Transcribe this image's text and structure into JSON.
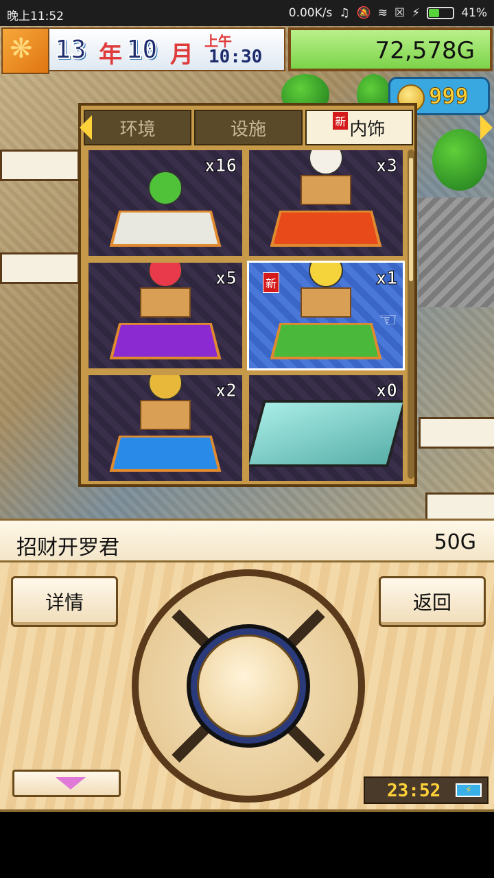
{
  "status_bar": {
    "time": "晚上11:52",
    "network_speed": "0.00K/s",
    "battery_percent": "41%",
    "battery_level": 0.41
  },
  "hud": {
    "year": "13",
    "year_unit": "年",
    "month": "10",
    "month_unit": "月",
    "ampm": "上午",
    "clock": "10:30",
    "money": "72,578G",
    "coins": "999"
  },
  "catalog": {
    "tabs": [
      {
        "label": "环境",
        "active": false,
        "is_new": false
      },
      {
        "label": "设施",
        "active": false,
        "is_new": false
      },
      {
        "label": "内饰",
        "active": true,
        "is_new": true,
        "new_badge": "新"
      }
    ],
    "items": [
      {
        "name": "bamboo-fountain",
        "count": "x16",
        "is_new": false,
        "selected": false,
        "figure_color": "#4fc23a",
        "base_color": "#e8e8e0"
      },
      {
        "name": "lucky-cat-statue",
        "count": "x3",
        "is_new": false,
        "selected": false,
        "figure_color": "#f4f0e8",
        "base_color": "#e84a1a"
      },
      {
        "name": "daruma-statue",
        "count": "x5",
        "is_new": false,
        "selected": false,
        "figure_color": "#e83a4a",
        "base_color": "#8a2ad0"
      },
      {
        "name": "golden-daruma-statue",
        "count": "x1",
        "is_new": true,
        "new_badge": "新",
        "selected": true,
        "figure_color": "#f4d43a",
        "base_color": "#4ab83a"
      },
      {
        "name": "treasure-ship-statue",
        "count": "x2",
        "is_new": false,
        "selected": false,
        "figure_color": "#e8b83a",
        "base_color": "#2a8ae8"
      },
      {
        "name": "glass-display-counter",
        "count": "x0",
        "is_new": false,
        "selected": false,
        "figure_color": "#7ed6d0",
        "base_color": "#333333"
      }
    ]
  },
  "info_bar": {
    "item_name": "招财开罗君",
    "price": "50G"
  },
  "controls": {
    "details_label": "详情",
    "back_label": "返回",
    "game_time": "23:52"
  }
}
